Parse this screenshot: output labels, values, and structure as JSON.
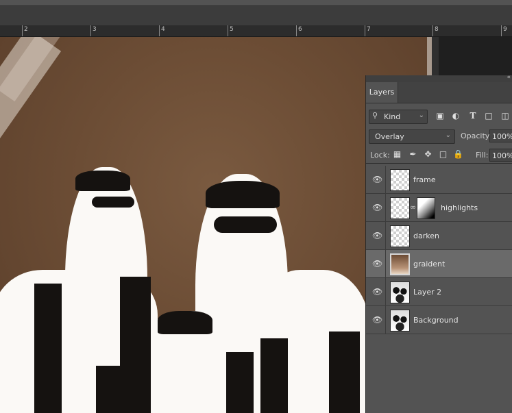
{
  "ruler": {
    "marks": [
      "2",
      "3",
      "4",
      "5",
      "6",
      "7",
      "8",
      "9"
    ]
  },
  "panel": {
    "title": "Layers",
    "filter": {
      "label": "Kind",
      "icons": [
        "image-filter-icon",
        "adjustment-filter-icon",
        "type-filter-icon",
        "shape-filter-icon",
        "smart-object-filter-icon"
      ]
    },
    "blend_mode": "Overlay",
    "opacity_label": "Opacity:",
    "opacity_value": "100%",
    "lock_label": "Lock:",
    "fill_label": "Fill:",
    "fill_value": "100%",
    "layers": [
      {
        "name": "frame",
        "thumb": "transparent",
        "mask": false,
        "selected": false,
        "visible": true
      },
      {
        "name": "highlights",
        "thumb": "transparent",
        "mask": true,
        "selected": false,
        "visible": true
      },
      {
        "name": "darken",
        "thumb": "transparent",
        "mask": false,
        "selected": false,
        "visible": true
      },
      {
        "name": "graident",
        "thumb": "gradient",
        "mask": false,
        "selected": true,
        "visible": true
      },
      {
        "name": "Layer 2",
        "thumb": "artwork",
        "mask": false,
        "selected": false,
        "visible": true
      },
      {
        "name": "Background",
        "thumb": "artwork",
        "mask": false,
        "selected": false,
        "visible": true
      }
    ]
  },
  "colors": {
    "canvas_brown": "#6c4d35",
    "panel_bg": "#535353",
    "selected_row": "#6a6a6a"
  }
}
